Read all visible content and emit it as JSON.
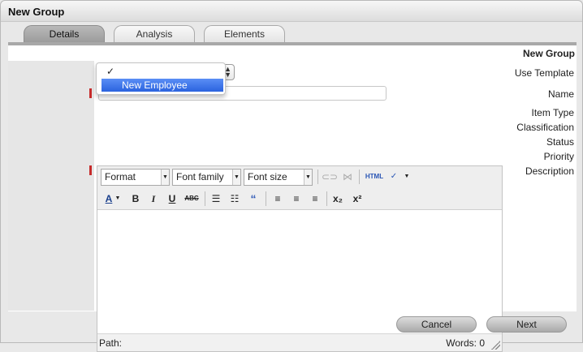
{
  "window": {
    "title": "New Group"
  },
  "tabs": [
    {
      "label": "Details",
      "active": true
    },
    {
      "label": "Analysis",
      "active": false
    },
    {
      "label": "Elements",
      "active": false
    }
  ],
  "form": {
    "heading": "New Group",
    "use_template_label": "Use Template",
    "name_label": "Name",
    "item_type_label": "Item Type",
    "classification_label": "Classification",
    "status_label": "Status",
    "priority_label": "Priority",
    "description_label": "Description",
    "name_value": ""
  },
  "template_dropdown": {
    "checkmark": "✓",
    "options": [
      {
        "label": "",
        "selected": true
      },
      {
        "label": "New Employee",
        "highlighted": true
      }
    ]
  },
  "editor": {
    "format_label": "Format",
    "font_family_label": "Font family",
    "font_size_label": "Font size",
    "html_label": "HTML",
    "path_label": "Path:",
    "words_label": "Words: 0"
  },
  "buttons": {
    "cancel": "Cancel",
    "next": "Next"
  },
  "colors": {
    "highlight": "#2b63df",
    "required": "#c62b2b"
  }
}
